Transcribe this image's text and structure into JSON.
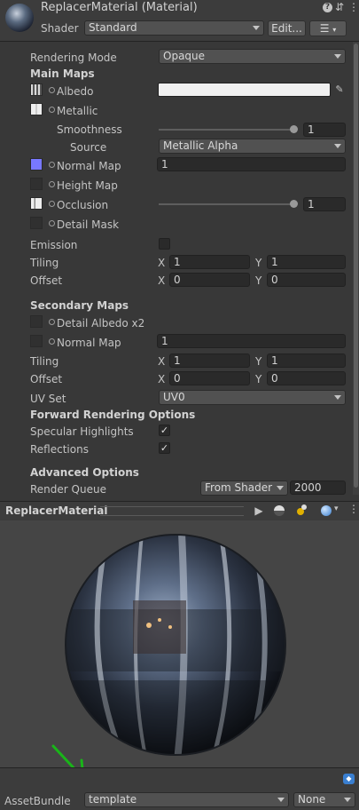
{
  "header": {
    "title": "ReplacerMaterial (Material)",
    "shader_label": "Shader",
    "shader_value": "Standard",
    "edit_button": "Edit...",
    "icons": [
      "help-icon",
      "settings-sliders-icon",
      "kebab-menu-icon",
      "list-icon"
    ]
  },
  "props": {
    "rendering_mode_label": "Rendering Mode",
    "rendering_mode_value": "Opaque",
    "main_maps": "Main Maps",
    "albedo": "Albedo",
    "metallic": "Metallic",
    "smoothness": "Smoothness",
    "smoothness_value": "1",
    "source": "Source",
    "source_value": "Metallic Alpha",
    "normal_map": "Normal Map",
    "normal_map_value": "1",
    "height_map": "Height Map",
    "occlusion": "Occlusion",
    "occlusion_value": "1",
    "detail_mask": "Detail Mask",
    "emission": "Emission",
    "tiling": "Tiling",
    "offset": "Offset",
    "x": "X",
    "y": "Y",
    "tiling_x": "1",
    "tiling_y": "1",
    "offset_x": "0",
    "offset_y": "0",
    "secondary_maps": "Secondary Maps",
    "detail_albedo": "Detail Albedo x2",
    "normal_map2": "Normal Map",
    "normal_map2_value": "1",
    "tiling2_x": "1",
    "tiling2_y": "1",
    "offset2_x": "0",
    "offset2_y": "0",
    "uv_set": "UV Set",
    "uv_set_value": "UV0",
    "forward_rendering": "Forward Rendering Options",
    "specular_highlights": "Specular Highlights",
    "reflections": "Reflections",
    "advanced_options": "Advanced Options",
    "render_queue": "Render Queue",
    "render_queue_mode": "From Shader",
    "render_queue_value": "2000",
    "checkmark": "✓"
  },
  "preview": {
    "title": "ReplacerMaterial"
  },
  "footer": {
    "assetbundle_label": "AssetBundle",
    "assetbundle_value": "template",
    "variant_value": "None"
  },
  "colors": {
    "normal_map_swatch": "#7878ff",
    "annotation_arrow": "#19b519"
  }
}
